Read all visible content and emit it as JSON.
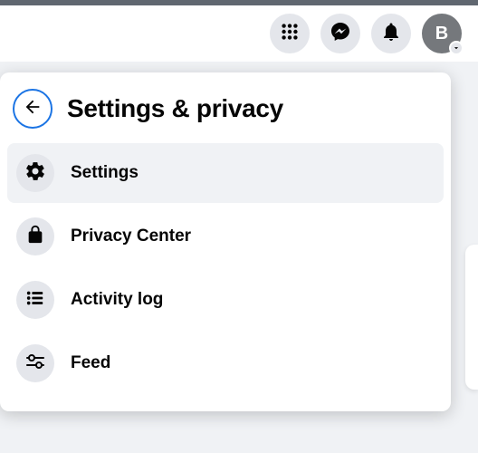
{
  "header": {
    "avatar_initial": "B"
  },
  "panel": {
    "title": "Settings & privacy",
    "items": [
      {
        "label": "Settings"
      },
      {
        "label": "Privacy Center"
      },
      {
        "label": "Activity log"
      },
      {
        "label": "Feed"
      }
    ]
  }
}
